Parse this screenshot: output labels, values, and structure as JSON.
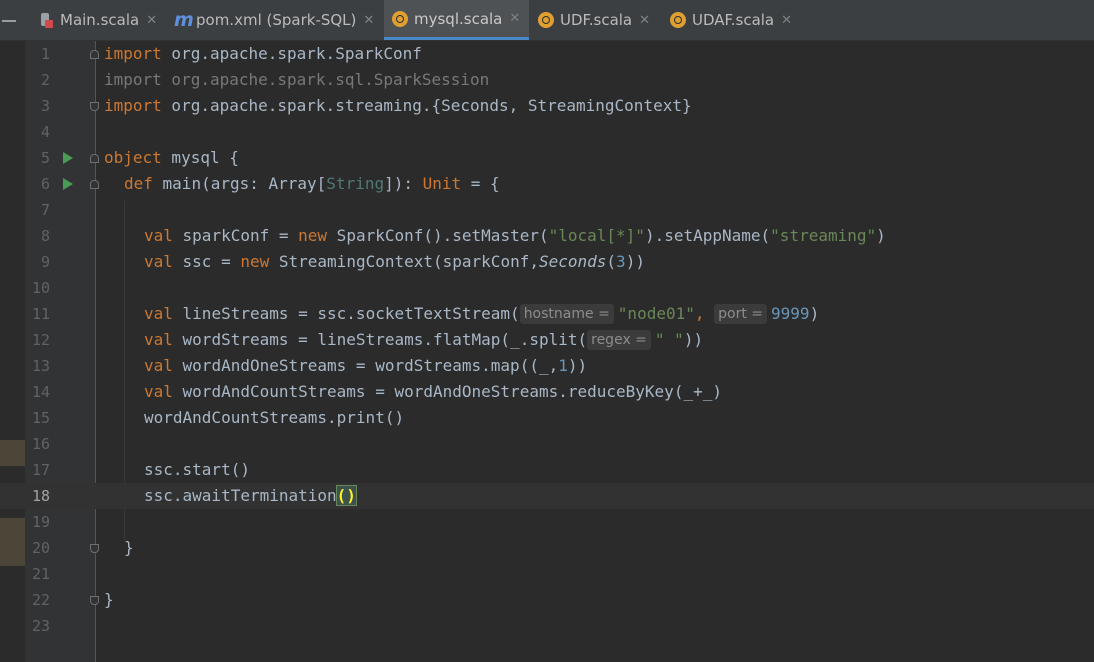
{
  "tabs": [
    {
      "name": "Main.scala",
      "icon": "scala-file-icon",
      "active": false
    },
    {
      "name": "pom.xml (Spark-SQL)",
      "icon": "maven-icon",
      "active": false
    },
    {
      "name": "mysql.scala",
      "icon": "scala-object-icon",
      "active": true
    },
    {
      "name": "UDF.scala",
      "icon": "scala-object-icon",
      "active": false
    },
    {
      "name": "UDAF.scala",
      "icon": "scala-object-icon",
      "active": false
    }
  ],
  "tab_close_glyph": "✕",
  "line_numbers": [
    "1",
    "2",
    "3",
    "4",
    "5",
    "6",
    "7",
    "8",
    "9",
    "10",
    "11",
    "12",
    "13",
    "14",
    "15",
    "16",
    "17",
    "18",
    "19",
    "20",
    "21",
    "22",
    "23"
  ],
  "code": {
    "l1_kw": "import",
    "l1_rest": " org.apache.spark.SparkConf",
    "l2": "import org.apache.spark.sql.SparkSession",
    "l3_kw": "import",
    "l3_rest": " org.apache.spark.streaming.{Seconds, StreamingContext}",
    "l5_kw": "object",
    "l5_rest": " mysql {",
    "l6_kw": "def",
    "l6_a": " main(args: Array[",
    "l6_type": "String",
    "l6_b": "]): ",
    "l6_unit": "Unit",
    "l6_c": " = {",
    "l8_kw": "val",
    "l8_a": " sparkConf = ",
    "l8_new": "new",
    "l8_b": " SparkConf().setMaster(",
    "l8_s1": "\"local[*]\"",
    "l8_c": ").setAppName(",
    "l8_s2": "\"streaming\"",
    "l8_d": ")",
    "l9_kw": "val",
    "l9_a": " ssc = ",
    "l9_new": "new",
    "l9_b": " StreamingContext(sparkConf,",
    "l9_it": "Seconds",
    "l9_c": "(",
    "l9_n": "3",
    "l9_d": "))",
    "l11_kw": "val",
    "l11_a": " lineStreams = ssc.socketTextStream(",
    "l11_h1": "hostname =",
    "l11_s": "\"node01\"",
    "l11_comma": ",",
    "l11_h2": "port =",
    "l11_n": "9999",
    "l11_end": ")",
    "l12_kw": "val",
    "l12_a": " wordStreams = lineStreams.flatMap(_.split(",
    "l12_h": "regex =",
    "l12_s": "\" \"",
    "l12_end": "))",
    "l13_kw": "val",
    "l13_a": " wordAndOneStreams = wordStreams.map((_,",
    "l13_n": "1",
    "l13_end": "))",
    "l14_kw": "val",
    "l14_a": " wordAndCountStreams = wordAndOneStreams.reduceByKey(_+_)",
    "l15": "wordAndCountStreams.print()",
    "l17": "ssc.start()",
    "l18_a": "ssc.awaitTermination",
    "l18_paren": "()",
    "l20": "}",
    "l22": "}"
  },
  "colors": {
    "keyword": "#cc7832",
    "string": "#6a8759",
    "number": "#6897bb",
    "text": "#a9b7c6",
    "active_tab_underline": "#4a88c7"
  }
}
